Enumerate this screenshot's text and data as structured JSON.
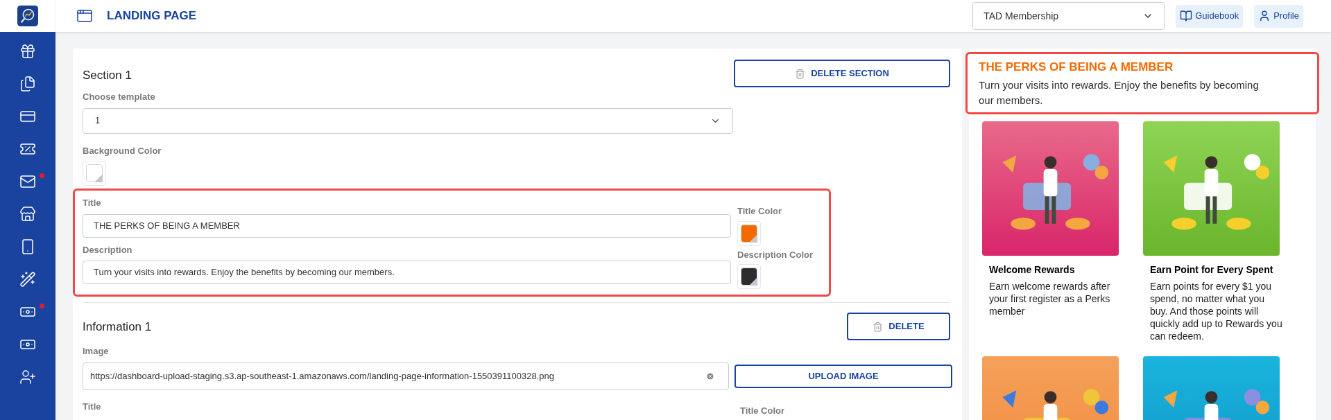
{
  "header": {
    "title": "LANDING PAGE",
    "membership_select": "TAD Membership",
    "buttons": [
      {
        "label": "Guidebook"
      },
      {
        "label": "Profile"
      }
    ]
  },
  "sidebar": {
    "items": [
      {
        "badge": false
      },
      {
        "badge": false
      },
      {
        "badge": false
      },
      {
        "badge": false
      },
      {
        "badge": true
      },
      {
        "badge": false
      },
      {
        "badge": false
      },
      {
        "badge": false
      },
      {
        "badge": true
      },
      {
        "badge": false
      },
      {
        "badge": false
      }
    ]
  },
  "section": {
    "heading": "Section 1",
    "delete_button": "DELETE SECTION",
    "template_label": "Choose template",
    "template_value": "1",
    "highlighted": true,
    "title_label": "Title",
    "title_value": "THE PERKS OF BEING A MEMBER",
    "description_label": "Description",
    "description_value": "Turn your visits into rewards. Enjoy the benefits by becoming our members.",
    "color_settings": [
      {
        "label": "Background Color",
        "color": "#ffffff"
      },
      {
        "label": "Title Color",
        "color": "#f56a00"
      },
      {
        "label": "Description Color",
        "color": "#2d2d2d"
      }
    ]
  },
  "information": {
    "heading": "Information 1",
    "delete_button": "DELETE",
    "image_label": "Image",
    "image_value": "https://dashboard-upload-staging.s3.ap-southeast-1.amazonaws.com/landing-page-information-1550391100328.png",
    "upload_button": "UPLOAD IMAGE",
    "title_label": "Title",
    "title_color_label": "Title Color"
  },
  "preview": {
    "highlighted": true,
    "title": "THE PERKS OF BEING A MEMBER",
    "description": "Turn your visits into rewards. Enjoy the benefits by becoming our members.",
    "cards": [
      {
        "kind": "picture",
        "title": "Welcome Rewards",
        "description": "Earn welcome rewards after your first register as a Perks member"
      },
      {
        "kind": "picture",
        "title": "Earn Point for Every Spent",
        "description": "Earn points for every $1 you spend, no matter what you buy. And those points will quickly add up to Rewards you can redeem."
      },
      {
        "kind": "picture"
      },
      {
        "kind": "picture"
      }
    ]
  }
}
